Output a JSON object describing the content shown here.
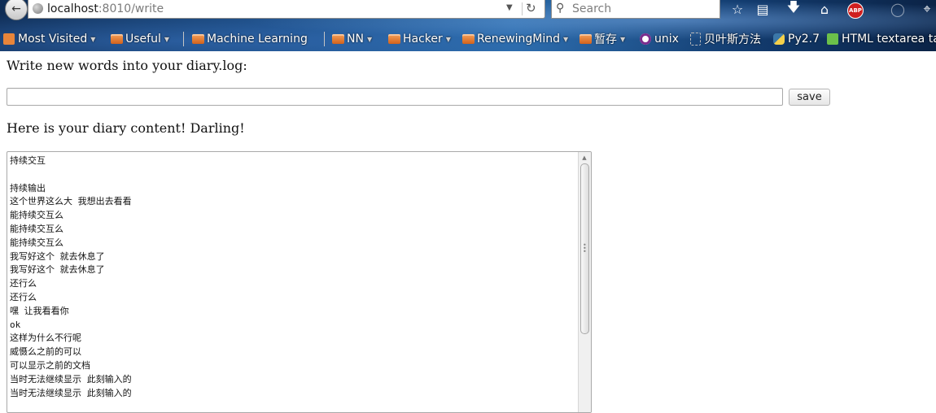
{
  "browser": {
    "url_host": "localhost",
    "url_rest": ":8010/write",
    "search_placeholder": "Search",
    "abp_label": "ABP"
  },
  "bookmarks": [
    {
      "label": "Most Visited",
      "icon": "rss-icon"
    },
    {
      "label": "Useful",
      "icon": "folder-icon"
    },
    {
      "label": "Machine Learning",
      "icon": "folder-icon"
    },
    {
      "label": "NN",
      "icon": "folder-icon"
    },
    {
      "label": "Hacker",
      "icon": "folder-icon"
    },
    {
      "label": "RenewingMind",
      "icon": "folder-icon"
    },
    {
      "label": "暂存",
      "icon": "folder-icon"
    },
    {
      "label": "unix",
      "icon": "site-favicon"
    },
    {
      "label": "贝叶斯方法",
      "icon": "page-icon"
    },
    {
      "label": "Py2.7",
      "icon": "python-icon"
    },
    {
      "label": "HTML textarea ta",
      "icon": "page-icon"
    }
  ],
  "page": {
    "heading_write": "Write new words into your diary.log:",
    "input_value": "",
    "save_label": "save",
    "heading_content": "Here is your diary content! Darling!",
    "diary_lines": [
      "持续交互",
      "",
      "持续输出",
      "这个世界这么大 我想出去看看",
      "能持续交互么",
      "能持续交互么",
      "能持续交互么",
      "我写好这个 就去休息了",
      "我写好这个 就去休息了",
      "还行么",
      "还行么",
      "嘿 让我看看你",
      "ok",
      "这样为什么不行呢",
      "威慑么之前的可以",
      "可以显示之前的文档",
      "当时无法继续显示 此刻输入的",
      "当时无法继续显示 此刻输入的"
    ]
  }
}
